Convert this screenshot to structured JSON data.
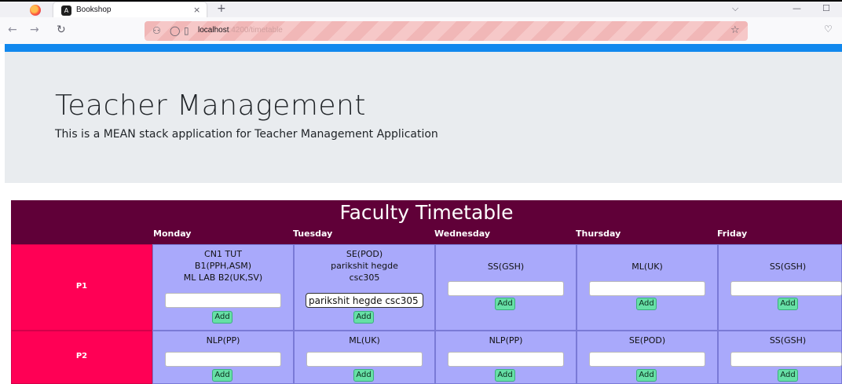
{
  "browser": {
    "tab_title": "Bookshop",
    "tab_close": "×",
    "new_tab": "+",
    "url_host": "localhost",
    "url_path": ":4200/timetable"
  },
  "jumbotron": {
    "title": "Teacher Management",
    "subtitle": "This is a MEAN stack application for Teacher Management Application"
  },
  "timetable": {
    "title": "Faculty Timetable",
    "days": [
      "Monday",
      "Tuesday",
      "Wednesday",
      "Thursday",
      "Friday"
    ],
    "add_label": "Add",
    "rows": [
      {
        "period": "P1",
        "cells": [
          {
            "text": "CN1 TUT\nB1(PPH,ASM)\nML LAB B2(UK,SV)",
            "input": ""
          },
          {
            "text": "SE(POD)\nparikshit hegde\ncsc305",
            "input": "parikshit hegde csc305"
          },
          {
            "text": "SS(GSH)",
            "input": ""
          },
          {
            "text": "ML(UK)",
            "input": ""
          },
          {
            "text": "SS(GSH)",
            "input": ""
          }
        ]
      },
      {
        "period": "P2",
        "cells": [
          {
            "text": "NLP(PP)",
            "input": ""
          },
          {
            "text": "ML(UK)",
            "input": ""
          },
          {
            "text": "NLP(PP)",
            "input": ""
          },
          {
            "text": "SE(POD)",
            "input": ""
          },
          {
            "text": "SS(GSH)",
            "input": ""
          }
        ]
      }
    ]
  },
  "colors": {
    "header_bg": "#600038",
    "period_bg": "#ff0055",
    "cell_bg": "#a9a9fb",
    "add_btn": "#66e0a6",
    "accent_bar": "#1188ee"
  }
}
